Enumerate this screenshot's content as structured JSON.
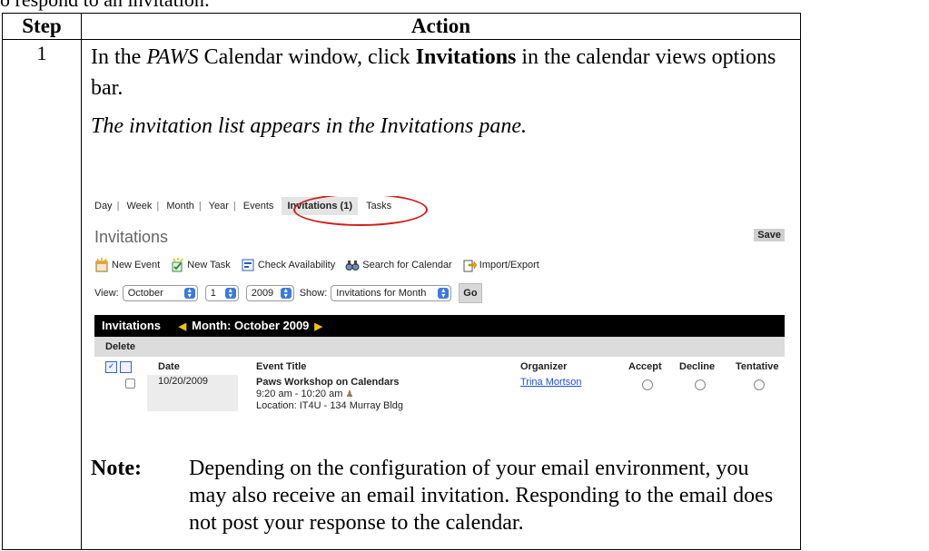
{
  "intro": "o respond to an invitation:",
  "table": {
    "col_step": "Step",
    "col_action": "Action",
    "row1": {
      "step": "1",
      "line1_a": "In the ",
      "line1_em": "PAWS",
      "line1_b": " Calendar window, click ",
      "line1_strong": "Invitations",
      "line1_c": " in the calendar views options bar.",
      "result": "The invitation list appears in the Invitations pane."
    }
  },
  "screenshot": {
    "views": [
      "Day",
      "Week",
      "Month",
      "Year",
      "Events"
    ],
    "active_tab": "Invitations (1)",
    "tasks_tab": "Tasks",
    "pane_title": "Invitations",
    "save_label": "Save",
    "toolbar": [
      "New Event",
      "New Task",
      "Check Availability",
      "Search for Calendar",
      "Import/Export"
    ],
    "view_label": "View:",
    "month_value": "October",
    "day_value": "1",
    "year_value": "2009",
    "show_label": "Show:",
    "show_value": "Invitations for Month",
    "go_label": "Go",
    "bar_title": "Invitations",
    "bar_month": "Month: October 2009",
    "delete_label": "Delete",
    "headers": {
      "date": "Date",
      "event_title": "Event Title",
      "organizer": "Organizer",
      "accept": "Accept",
      "decline": "Decline",
      "tentative": "Tentative"
    },
    "row": {
      "date": "10/20/2009",
      "title": "Paws Workshop on Calendars",
      "time": "9:20 am - 10:20 am",
      "location": "Location: IT4U - 134 Murray Bldg",
      "organizer": "Trina Mortson"
    },
    "colors": {
      "highlight_circle": "#d21c1c",
      "bar_background": "#000000",
      "bar_arrows": "#f3c400",
      "link": "#1f4fd6"
    }
  },
  "note": {
    "label": "Note:",
    "text": "Depending on the configuration of your email environment, you may also receive an email invitation. Responding to the email does not post your response to the calendar."
  }
}
